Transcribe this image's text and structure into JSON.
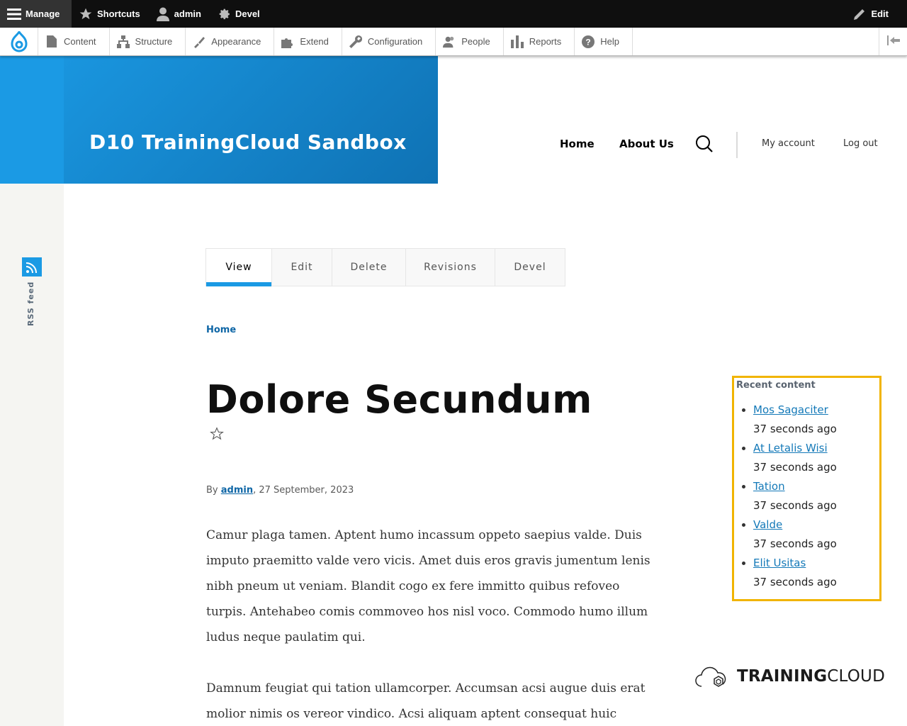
{
  "toolbar": {
    "manage": "Manage",
    "shortcuts": "Shortcuts",
    "user": "admin",
    "devel": "Devel",
    "edit": "Edit"
  },
  "tray": {
    "items": [
      "Content",
      "Structure",
      "Appearance",
      "Extend",
      "Configuration",
      "People",
      "Reports",
      "Help"
    ]
  },
  "header": {
    "site_name": "D10 TrainingCloud Sandbox",
    "nav": [
      "Home",
      "About Us"
    ],
    "account": [
      "My account",
      "Log out"
    ]
  },
  "sidebar": {
    "rss_label": "RSS feed"
  },
  "tabs": [
    "View",
    "Edit",
    "Delete",
    "Revisions",
    "Devel"
  ],
  "breadcrumb": "Home",
  "article": {
    "title": "Dolore Secundum",
    "by": "By",
    "author": "admin",
    "date": ", 27 September, 2023",
    "paragraphs": [
      "Camur plaga tamen. Aptent humo incassum oppeto saepius valde. Duis imputo praemitto valde vero vicis. Amet duis eros gravis jumentum lenis nibh pneum ut veniam. Blandit cogo ex fere immitto quibus refoveo turpis. Antehabeo comis commoveo hos nisl voco. Commodo humo illum ludus neque paulatim qui.",
      "Damnum feugiat qui tation ullamcorper. Accumsan acsi augue duis erat molior nimis os vereor vindico. Acsi aliquam aptent consequat huic luctus"
    ]
  },
  "recent": {
    "title": "Recent content",
    "items": [
      {
        "label": "Mos Sagaciter",
        "ago": "37 seconds ago"
      },
      {
        "label": "At Letalis Wisi",
        "ago": "37 seconds ago"
      },
      {
        "label": "Tation",
        "ago": "37 seconds ago"
      },
      {
        "label": "Valde",
        "ago": "37 seconds ago"
      },
      {
        "label": "Elit Usitas",
        "ago": "37 seconds ago"
      }
    ]
  },
  "logo": {
    "bold": "TRAINING",
    "light": "CLOUD"
  },
  "colors": {
    "brand_blue": "#1b9ae4",
    "highlight": "#f1b400",
    "link": "#1479b8"
  }
}
